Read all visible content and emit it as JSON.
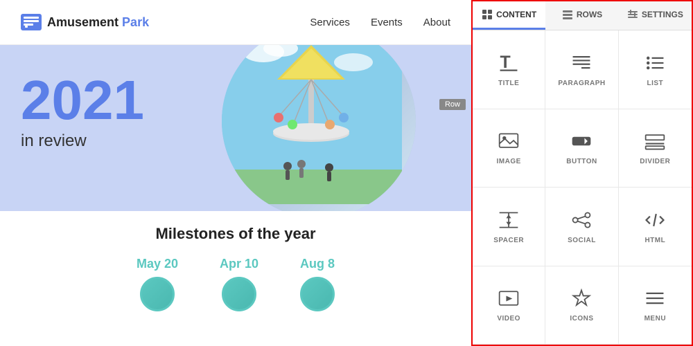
{
  "preview": {
    "logo": {
      "text_amusement": "Amusement",
      "text_park": "Park"
    },
    "nav": {
      "items": [
        "Services",
        "Events",
        "About"
      ]
    },
    "hero": {
      "year": "2021",
      "subtitle": "in review",
      "row_badge": "Row"
    },
    "milestones": {
      "title": "Milestones of the year",
      "dates": [
        "May 20",
        "Apr 10",
        "Aug 8"
      ]
    }
  },
  "sidebar": {
    "tabs": [
      {
        "id": "content",
        "label": "CONTENT",
        "icon": "⊞",
        "active": true
      },
      {
        "id": "rows",
        "label": "ROWS",
        "icon": "☰"
      },
      {
        "id": "settings",
        "label": "SETTINGS",
        "icon": "⚙"
      }
    ],
    "content_items": [
      {
        "id": "title",
        "label": "TITLE"
      },
      {
        "id": "paragraph",
        "label": "PARAGRAPH"
      },
      {
        "id": "list",
        "label": "LIST"
      },
      {
        "id": "image",
        "label": "IMAGE"
      },
      {
        "id": "button",
        "label": "BUTTON"
      },
      {
        "id": "divider",
        "label": "DIVIDER"
      },
      {
        "id": "spacer",
        "label": "SPACER"
      },
      {
        "id": "social",
        "label": "SOCIAL"
      },
      {
        "id": "html",
        "label": "HTML"
      },
      {
        "id": "video",
        "label": "VIDEO"
      },
      {
        "id": "icons",
        "label": "ICONS"
      },
      {
        "id": "menu",
        "label": "MENU"
      }
    ]
  }
}
